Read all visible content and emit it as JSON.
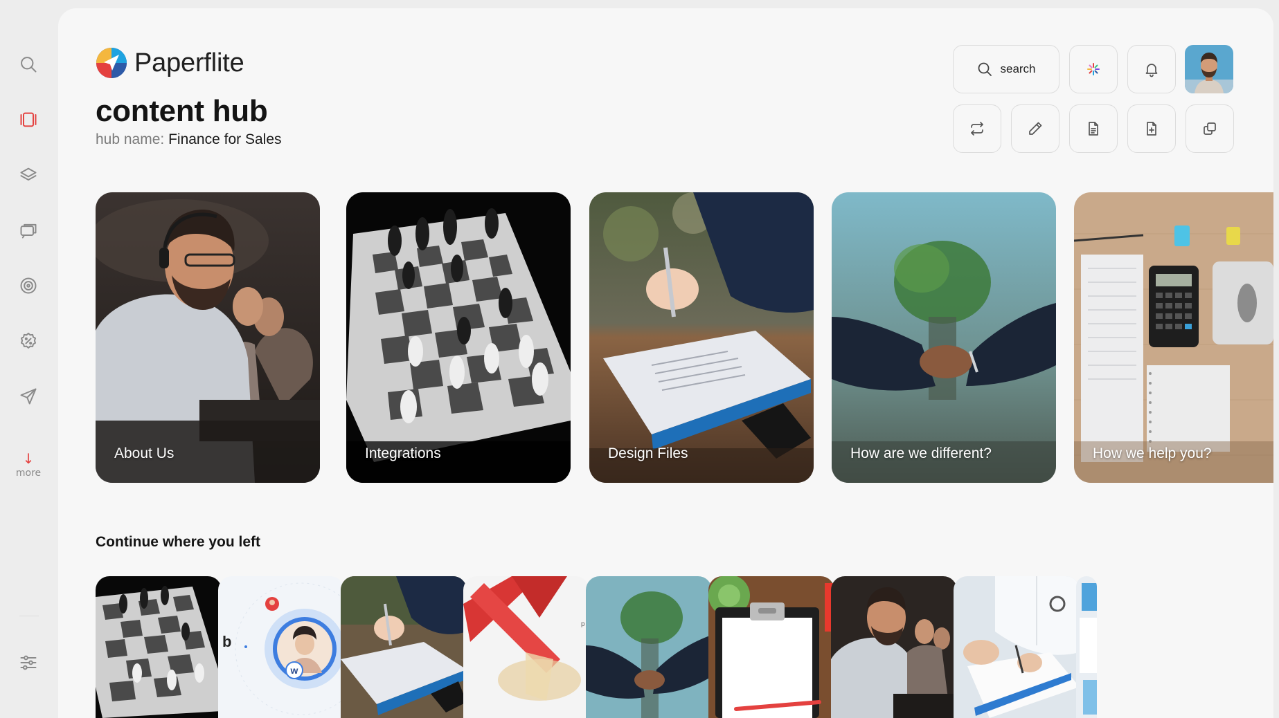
{
  "brand": {
    "name": "Paperflite"
  },
  "page": {
    "title": "content hub",
    "hub_prefix": "hub name: ",
    "hub_name": "Finance for Sales"
  },
  "toolbar": {
    "search_label": "search"
  },
  "sidebar": {
    "items": [
      {
        "icon": "search-icon"
      },
      {
        "icon": "hub-cards-icon",
        "active": true
      },
      {
        "icon": "layers-icon"
      },
      {
        "icon": "chat-icon"
      },
      {
        "icon": "target-icon"
      },
      {
        "icon": "settings-percent-icon"
      },
      {
        "icon": "send-icon"
      }
    ],
    "more_label": "more",
    "bottom_icon": "sliders-icon"
  },
  "collections": [
    {
      "label": "About Us"
    },
    {
      "label": "Integrations"
    },
    {
      "label": "Design Files"
    },
    {
      "label": "How are we different?"
    },
    {
      "label": "How we help you?"
    }
  ],
  "recent": {
    "title": "Continue where you left"
  },
  "colors": {
    "accent": "#e4413f",
    "background": "#f7f7f7"
  }
}
